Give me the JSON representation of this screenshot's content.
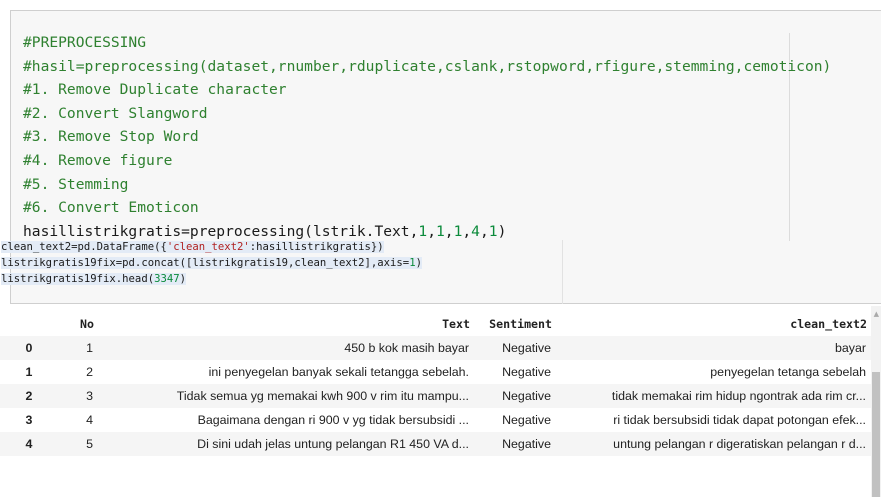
{
  "code_cell": {
    "comment_lines": [
      "#PREPROCESSING",
      "#hasil=preprocessing(dataset,rnumber,rduplicate,cslank,rstopword,rfigure,stemming,cemoticon)",
      "#1. Remove Duplicate character",
      "#2. Convert Slangword",
      "#3. Remove Stop Word",
      "#4. Remove figure",
      "#5. Stemming",
      "#6. Convert Emoticon"
    ],
    "call_prefix": "hasillistrikgratis=preprocessing(lstrik.Text,",
    "call_args": [
      "1",
      ",",
      "1",
      ",",
      "1",
      ",",
      "4",
      ",",
      "1"
    ],
    "call_suffix": ")",
    "line2_prefix": "clean_text2=pd.DataFrame({",
    "line2_string": "'clean_text2'",
    "line2_suffix": ":hasillistrikgratis})",
    "line3_prefix": "listrikgratis19fix=pd.concat([listrikgratis19,clean_text2],axis=",
    "line3_num": "1",
    "line3_suffix": ")",
    "line4_prefix": "listrikgratis19fix.head(",
    "line4_num": "3347",
    "line4_suffix": ")"
  },
  "table": {
    "columns": [
      "",
      "No",
      "Text",
      "Sentiment",
      "clean_text2"
    ],
    "rows": [
      {
        "index": "0",
        "no": "1",
        "text": "450 b kok masih bayar",
        "sentiment": "Negative",
        "clean": "bayar"
      },
      {
        "index": "1",
        "no": "2",
        "text": "ini penyegelan banyak sekali tetangga sebelah.",
        "sentiment": "Negative",
        "clean": "penyegelan tetanga sebelah"
      },
      {
        "index": "2",
        "no": "3",
        "text": "Tidak semua yg memakai kwh 900 v rim itu mampu...",
        "sentiment": "Negative",
        "clean": "tidak memakai rim hidup ngontrak ada rim cr..."
      },
      {
        "index": "3",
        "no": "4",
        "text": "Bagaimana dengan ri 900 v yg tidak bersubsidi ...",
        "sentiment": "Negative",
        "clean": "ri tidak bersubsidi tidak dapat potongan efek..."
      },
      {
        "index": "4",
        "no": "5",
        "text": "Di sini udah jelas untung pelangan R1 450 VA d...",
        "sentiment": "Negative",
        "clean": "untung pelangan r digeratiskan pelangan r d..."
      }
    ]
  }
}
